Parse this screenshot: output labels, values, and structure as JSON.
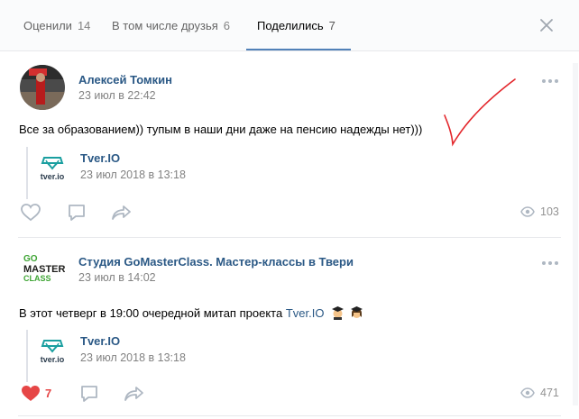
{
  "tabs": [
    {
      "label": "Оценили",
      "count": "14"
    },
    {
      "label": "В том числе друзья",
      "count": "6"
    },
    {
      "label": "Поделились",
      "count": "7"
    }
  ],
  "posts": [
    {
      "author": "Алексей Томкин",
      "date": "23 июл в 22:42",
      "text": "Все за образованием)) тупым в наши дни даже на пенсию надежды нет)))",
      "repost": {
        "title": "Tver.IO",
        "date": "23 июл 2018 в 13:18"
      },
      "likes": "",
      "views": "103"
    },
    {
      "author": "Студия GoMasterClass. Мастер-классы в Твери",
      "date": "23 июл в 14:02",
      "text": "В этот четверг в 19:00 очередной митап проекта",
      "text_link": "Tver.IO",
      "repost": {
        "title": "Tver.IO",
        "date": "23 июл 2018 в 13:18"
      },
      "likes": "7",
      "views": "471"
    }
  ],
  "logos": {
    "gomasterclass": [
      "GO",
      "MASTER",
      "CLASS"
    ],
    "tverio": "tver.io"
  },
  "colors": {
    "accent": "#5181b8",
    "link": "#2a5885",
    "like_active": "#e64646",
    "annotation": "#e3262b"
  }
}
